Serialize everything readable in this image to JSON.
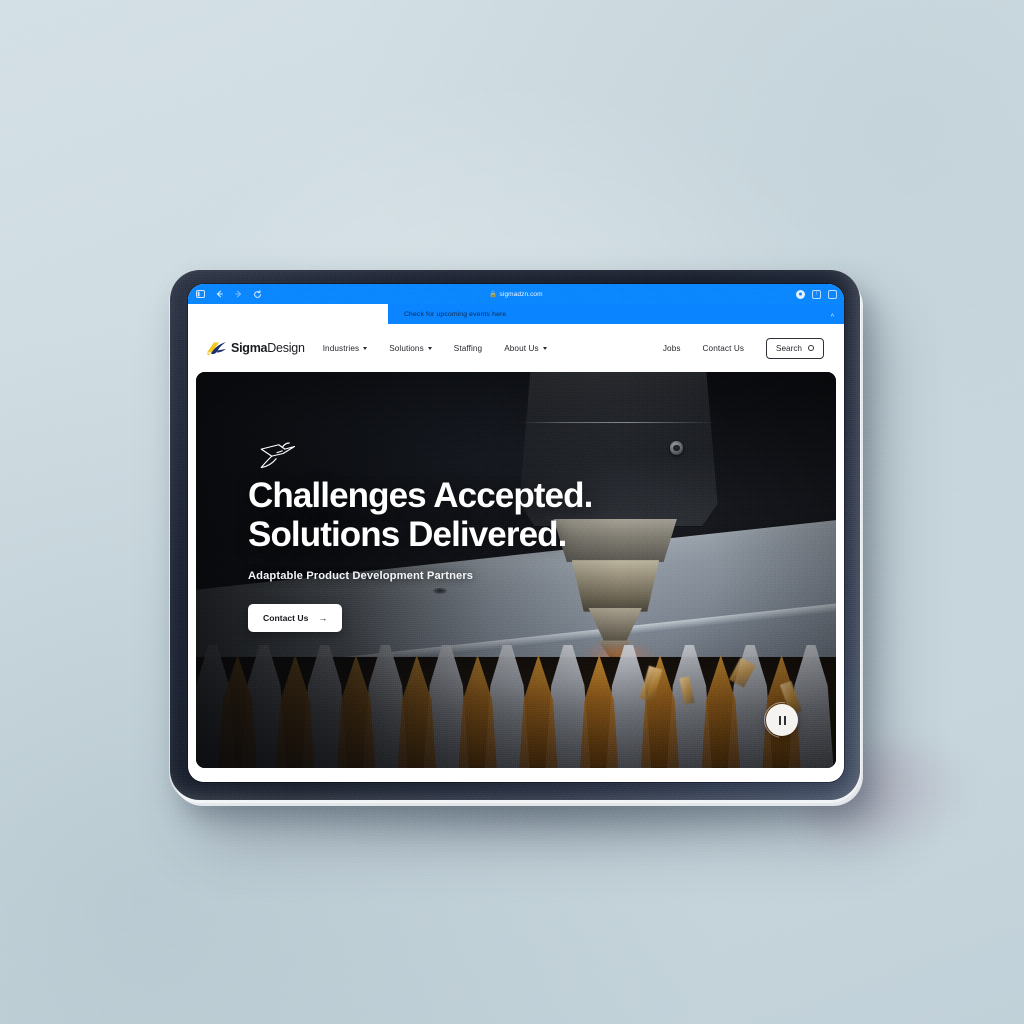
{
  "browser": {
    "url": "sigmadzn.com",
    "lock_icon": "lock-icon",
    "sidebar_icon": "sidebar-toggle-icon",
    "back_icon": "back-arrow-icon",
    "forward_icon": "forward-arrow-icon",
    "reload_icon": "reload-icon",
    "extension_icon": "extension-icon",
    "share_icon": "share-icon",
    "tabs_icon": "tab-overview-icon"
  },
  "banner": {
    "text": "Check for upcoming events here",
    "collapse_glyph": "^",
    "background": "#0a84ff",
    "text_color": "#0d2c52"
  },
  "nav": {
    "brand": {
      "bold": "Sigma",
      "regular": "Design",
      "mark": "hummingbird-logo-mark"
    },
    "links": [
      {
        "label": "Industries",
        "has_dropdown": true
      },
      {
        "label": "Solutions",
        "has_dropdown": true
      },
      {
        "label": "Staffing",
        "has_dropdown": false
      },
      {
        "label": "About Us",
        "has_dropdown": true
      }
    ],
    "right_links": [
      {
        "label": "Jobs"
      },
      {
        "label": "Contact Us"
      }
    ],
    "search": {
      "label": "Search",
      "icon": "search-icon"
    }
  },
  "hero": {
    "bird_icon": "hummingbird-icon",
    "headline_line1": "Challenges Accepted.",
    "headline_line2": "Solutions Delivered.",
    "subhead": "Adaptable Product Development Partners",
    "cta": {
      "label": "Contact Us",
      "arrow": "→"
    },
    "pause_control": "pause-icon",
    "image_subject": "fiber laser cutting head cutting a metal sheet on a slat bed"
  },
  "theme": {
    "accent_blue": "#0a84ff",
    "brand_yellow": "#f5c518",
    "brand_navy": "#1a2c6b",
    "page_bg": "#ffffff",
    "scene_bg": "#cddbe1",
    "device_frame": "#1c2231"
  }
}
